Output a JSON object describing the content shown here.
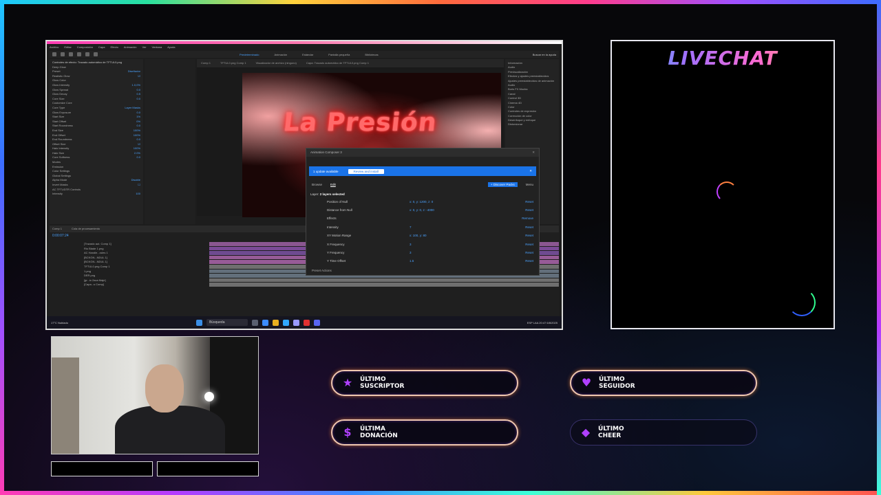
{
  "colors": {
    "accent_purple": "#b040ff",
    "alert_border": "#f0c8b0",
    "ae_blue": "#4ba3ff",
    "update_blue": "#1a73e8"
  },
  "after_effects": {
    "menu": [
      "Archivo",
      "Editar",
      "Composición",
      "Capa",
      "Efecto",
      "Animación",
      "Ver",
      "Ventana",
      "Ayuda"
    ],
    "workspaces": [
      "Predeterminado",
      "Animación",
      "Estándar",
      "Pantalla pequeña",
      "Bibliotecas"
    ],
    "search_label": "Buscar en la ayuda",
    "comp_tabs": [
      "Comp 1",
      "TFTUL0.png Comp 1",
      "Visualizador de archivo (ninguno)",
      "Capa: Trazado automático de TFTUL0.png Comp 1"
    ],
    "comp_title_text": "La Presión",
    "effects_panel": {
      "header": "Controles de efecto: Trazado automático de TFTUL0.png",
      "rows": [
        {
          "name": "Deep Glow",
          "value": ""
        },
        {
          "name": "Preset",
          "value": "Diseñador"
        },
        {
          "name": "Realistic Glow",
          "value": "☑"
        },
        {
          "name": "Glow Color",
          "value": ""
        },
        {
          "name": "Glow Intensity",
          "value": "1.0,0%"
        },
        {
          "name": "Glow Spread",
          "value": "0.0"
        },
        {
          "name": "Glow Decay",
          "value": "0.5"
        },
        {
          "name": "Core Size",
          "value": "0.0"
        },
        {
          "name": "Customize Core",
          "value": ""
        },
        {
          "name": "Core Type",
          "value": "Layer Masks"
        },
        {
          "name": "Glow Exposure",
          "value": "0.0"
        },
        {
          "name": "Start Size",
          "value": "1%"
        },
        {
          "name": "Start Offset",
          "value": "0%"
        },
        {
          "name": "Start Roundness",
          "value": "0.0"
        },
        {
          "name": "End Size",
          "value": "100%"
        },
        {
          "name": "End Offset",
          "value": "100%"
        },
        {
          "name": "End Roundness",
          "value": "0.0"
        },
        {
          "name": "Offset Size",
          "value": "☑"
        },
        {
          "name": "Halo Intensity",
          "value": "100%"
        },
        {
          "name": "Halo Size",
          "value": "2.0%"
        },
        {
          "name": "Core Softness",
          "value": "0.0"
        },
        {
          "name": "Modes",
          "value": ""
        },
        {
          "name": "Emission",
          "value": ""
        },
        {
          "name": "Color Settings",
          "value": ""
        },
        {
          "name": "Global Settings",
          "value": ""
        },
        {
          "name": "Alpha Mode",
          "value": "Disable"
        },
        {
          "name": "Invert Masks",
          "value": "☐"
        },
        {
          "name": "AC TFTUDTR Controls",
          "value": ""
        },
        {
          "name": "Intensity",
          "value": "100"
        }
      ]
    },
    "right_panel": [
      "Información",
      "Audio",
      "Previsualización",
      "Efectos y ajustes preestablecidos",
      "Ajustes preestablecidos de animación",
      "Audio",
      "Boris FX Mocha",
      "Canal",
      "Control 3D",
      "Cinema 4D",
      "Color",
      "Controles de expresión",
      "Corrección de color",
      "Desenfoque y enfoque",
      "Distorsionar"
    ],
    "timeline": {
      "tabs": [
        "Comp 1",
        "Cola de procesamiento"
      ],
      "timecode": "0:00:07:24",
      "layers": [
        "[Trazado aut. Comp 1]",
        "Rio Blade 1.png",
        "AC Handle...roles 1",
        "[BCKGN...NDUL 1]",
        "[BCKGN...NDUL 1]",
        "TFTUL0.png Comp 1",
        "1.png",
        "DER.png",
        "[gr...io 2aca Maje]",
        "[Capa...s Comp]"
      ],
      "bar_colors": [
        "#b06ab8",
        "#9a5ac0",
        "#8a5ab8",
        "#c070c0",
        "#c070c0",
        "#8a8a8a",
        "#7a8a9a",
        "#7a8a9a",
        "#8a8a8a",
        "#8a8a8a"
      ]
    },
    "taskbar": {
      "search": "Búsqueda",
      "lang": "ESP LAA",
      "time": "20:47",
      "date": "6/8/2025",
      "weather": "17°C Nublado"
    }
  },
  "animation_composer": {
    "title": "Animation Composer 3",
    "update_text": "1 update available",
    "update_button": "Review and install",
    "tabs": [
      "Browse",
      "Edit"
    ],
    "active_tab": "Edit",
    "discover_button": "+ Discover Packs",
    "menu": "Menu",
    "layer_label": "Layer:",
    "layer_value": "2 layers selected",
    "params": [
      {
        "name": "Position of Null",
        "value": "x: 0, y: 1200, z: 0",
        "reset": "Reset"
      },
      {
        "name": "Distance from Null",
        "value": "x: 0, y: 0, z: -4000",
        "reset": "Reset"
      },
      {
        "name": "Effects",
        "value": "",
        "reset": "Remove"
      },
      {
        "name": "Intensity",
        "value": "7",
        "reset": "Reset"
      },
      {
        "name": "XY Motion Range",
        "value": "x: 100, y: 80",
        "reset": "Reset"
      },
      {
        "name": "X Frequency",
        "value": "3",
        "reset": "Reset"
      },
      {
        "name": "Y Frequency",
        "value": "3",
        "reset": "Reset"
      },
      {
        "name": "Y Time Offset",
        "value": "1.5",
        "reset": "Reset"
      }
    ],
    "footer": "Preset Actions"
  },
  "livechat": {
    "title": "LIVECHAT"
  },
  "alerts": {
    "subscriber": "ÚLTIMO\nSUSCRIPTOR",
    "follower": "ÚLTIMO\nSEGUIDOR",
    "donation": "ÚLTIMA\nDONACIÓN",
    "cheer": "ÚLTIMO\nCHEER"
  },
  "icons": {
    "subscriber": "star-icon",
    "follower": "heart-icon",
    "donation": "dollar-icon",
    "cheer": "diamond-icon"
  }
}
